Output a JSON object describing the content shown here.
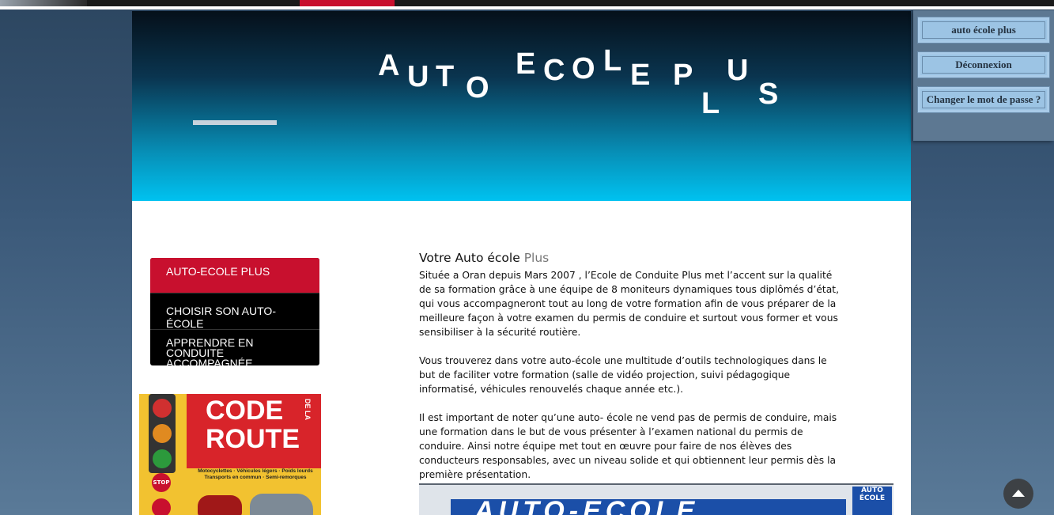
{
  "logo": {
    "text": "AUTO ECOLE PLUS"
  },
  "side_panel": {
    "site_button": "auto école plus",
    "logout_button": "Déconnexion",
    "password_button": "Changer le mot de passe ?"
  },
  "menu": {
    "items": [
      {
        "label": "AUTO-ECOLE PLUS"
      },
      {
        "label": "CHOISIR SON AUTO-ÉCOLE"
      },
      {
        "label": "APPRENDRE EN CONDUITE ACCOMPAGNÉE"
      }
    ]
  },
  "poster": {
    "title_line1": "CODE",
    "title_line2": "ROUTE",
    "title_vertical": "DE LA",
    "subtitle": "Motocyclettes · Véhicules légers · Poids lourds Transports en commun · Semi-remorques",
    "stop_label": "STOP"
  },
  "article": {
    "title_main": "Votre Auto école",
    "title_accent": "Plus",
    "paragraphs": [
      "Située a Oran depuis Mars 2007 , l’Ecole de Conduite Plus met l’accent sur la qualité de sa formation grâce à une équipe de 8 moniteurs dynamiques tous diplômés d’état, qui vous accompagneront tout au long de votre formation afin de vous préparer de la meilleure façon à votre examen du permis de conduire et surtout vous former et vous sensibiliser à la sécurité routière.",
      "Vous trouverez dans votre auto-école une multitude d’outils technologiques dans le but de faciliter votre formation (salle de vidéo projection, suivi pédagogique informatisé, véhicules renouvelés chaque année etc.).",
      "Il est important de noter qu’une auto- école ne vend pas de permis de conduire, mais une formation dans le but de vous présenter à l’examen national du permis de conduire. Ainsi notre équipe met tout en œuvre pour faire de nos élèves des conducteurs responsables, avec un niveau solide et qui obtiennent leur permis dès la première présentation."
    ]
  },
  "photo": {
    "sign_text": "AUTO-ECOLE",
    "corner_sign": "AUTO ÉCOLE"
  },
  "colors": {
    "accent_red": "#c8102e",
    "banner_top": "#05101a",
    "banner_bottom": "#00c2f0",
    "side_button_bg": "#9cc4e4"
  }
}
